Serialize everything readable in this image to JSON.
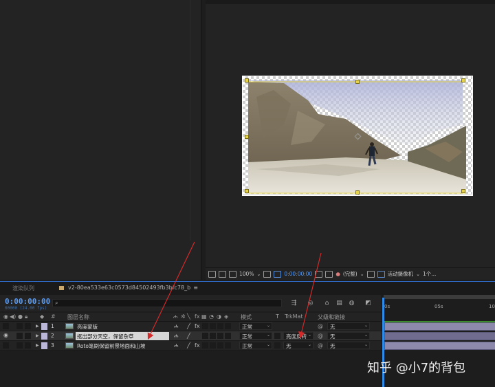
{
  "viewer_toolbar": {
    "zoom": "100%",
    "timecode": "0:00:00:00",
    "resolution": "(完整)",
    "camera": "活动摄像机",
    "views": "1个..."
  },
  "tabs": {
    "render_queue": "渲染队列",
    "comp_name": "v2-80ea533e63c0573d84502493fb3bfc78_b",
    "comp_menu": "≡"
  },
  "time": {
    "current": "0:00:00:00",
    "frames": "00000 (24.00 fps)"
  },
  "columns": {
    "num": "#",
    "layer_name": "图层名称",
    "mode": "模式",
    "t": "T",
    "trkmat": "TrkMat",
    "parent": "父级和链接"
  },
  "layers": [
    {
      "num": "1",
      "name": "亮度蒙版",
      "mode": "正常",
      "trkmat": "",
      "parent": "无"
    },
    {
      "num": "2",
      "name": "抠出部分天空，保留杂草",
      "mode": "正常",
      "trkmat": "亮度反转",
      "parent": "无"
    },
    {
      "num": "3",
      "name": "Roto笔刷保留前景地面和山坡",
      "mode": "正常",
      "trkmat": "无",
      "parent": "无"
    }
  ],
  "ruler": {
    "t0": "0s",
    "t5": "05s",
    "t10": "10"
  },
  "watermark": "知乎 @小7的背包",
  "colors": {
    "accent": "#2d8ceb",
    "timecode": "#5b9bf2",
    "layer_label": "#b9b6d8",
    "annotation_arrow": "#d42a2a",
    "guide_handles": "#e6d34a"
  }
}
